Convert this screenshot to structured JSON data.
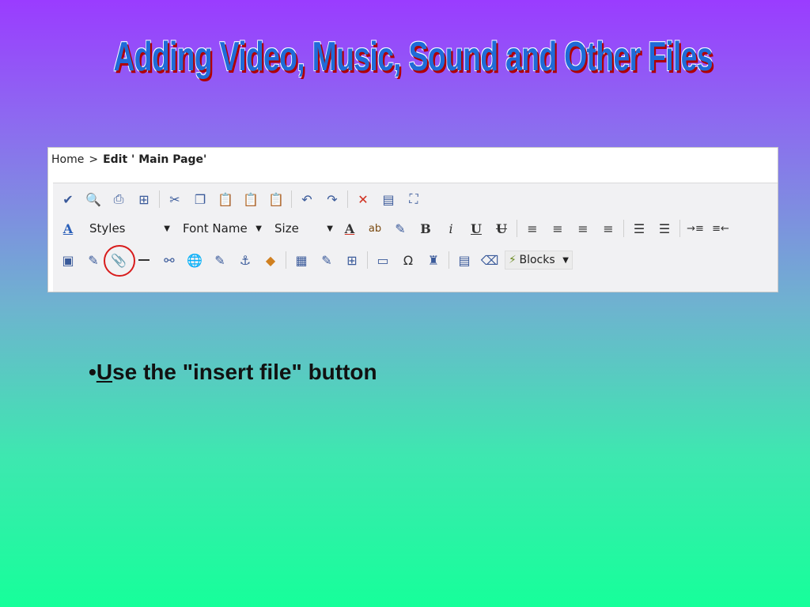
{
  "slide": {
    "title": "Adding Video, Music, Sound and Other Files",
    "bullet_mark": "•",
    "bullet_first_letter": "U",
    "bullet_rest": "se the \"insert file\" button"
  },
  "breadcrumb": {
    "home": "Home",
    "separator": ">",
    "current": "Edit ' Main Page'"
  },
  "toolbar": {
    "row1": [
      {
        "name": "spellcheck-icon",
        "glyph": "✔"
      },
      {
        "name": "preview-icon",
        "glyph": "🔍"
      },
      {
        "name": "print-icon",
        "glyph": "⎙"
      },
      {
        "name": "find-icon",
        "glyph": "⊞"
      },
      {
        "name": "cut-icon",
        "glyph": "✂"
      },
      {
        "name": "copy-icon",
        "glyph": "❐"
      },
      {
        "name": "paste-icon",
        "glyph": "📋"
      },
      {
        "name": "paste-word-icon",
        "glyph": "📋"
      },
      {
        "name": "paste-text-icon",
        "glyph": "📋"
      },
      {
        "name": "undo-icon",
        "glyph": "↶"
      },
      {
        "name": "redo-icon",
        "glyph": "↷"
      },
      {
        "name": "delete-icon",
        "glyph": "✕"
      },
      {
        "name": "source-icon",
        "glyph": "▤"
      },
      {
        "name": "presentation-icon",
        "glyph": "⛶"
      }
    ],
    "styles_label": "Styles",
    "font_name_label": "Font Name",
    "size_label": "Size",
    "format_glyphs": {
      "text_color": "A",
      "highlight": "ab",
      "marker": "✎",
      "bold": "B",
      "italic": "i",
      "underline": "U",
      "strike": "U",
      "align_left": "≡",
      "align_center": "≡",
      "align_right": "≡",
      "justify": "≡",
      "ordered_list": "☰",
      "unordered_list": "☰",
      "indent": "→≡",
      "outdent": "≡←"
    },
    "row3": [
      {
        "name": "image-icon",
        "glyph": "▣"
      },
      {
        "name": "edit-image-icon",
        "glyph": "✎"
      },
      {
        "name": "insert-file-icon",
        "glyph": "📎"
      },
      {
        "name": "horizontal-rule-icon",
        "glyph": "—"
      },
      {
        "name": "link-icon",
        "glyph": "⚯"
      },
      {
        "name": "globe-link-icon",
        "glyph": "🌐"
      },
      {
        "name": "edit-link-icon",
        "glyph": "✎"
      },
      {
        "name": "anchor-icon",
        "glyph": "⚓"
      },
      {
        "name": "media-icon",
        "glyph": "◆"
      },
      {
        "name": "table-icon",
        "glyph": "▦"
      },
      {
        "name": "edit-table-icon",
        "glyph": "✎"
      },
      {
        "name": "grid-icon",
        "glyph": "⊞"
      },
      {
        "name": "textbox-icon",
        "glyph": "▭"
      },
      {
        "name": "omega-icon",
        "glyph": "Ω"
      },
      {
        "name": "special-char-icon",
        "glyph": "♜"
      },
      {
        "name": "page-break-icon",
        "glyph": "▤"
      },
      {
        "name": "eraser-icon",
        "glyph": "⌫"
      }
    ],
    "blocks_label": "Blocks"
  },
  "colors": {
    "title_fill": "#1f6bd8",
    "title_shadow": "#b00000",
    "highlight_circle": "#d81c1c"
  }
}
